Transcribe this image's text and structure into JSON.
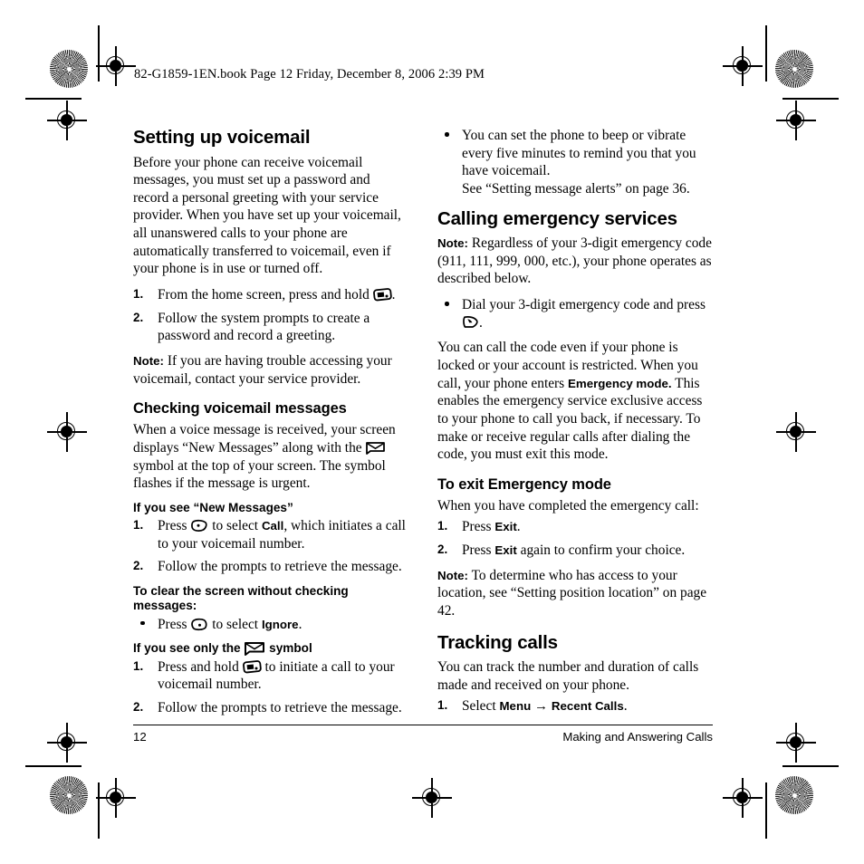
{
  "header": {
    "text": "82-G1859-1EN.book  Page 12  Friday, December 8, 2006  2:39 PM"
  },
  "left_column": {
    "heading": "Setting up voicemail",
    "intro": "Before your phone can receive voicemail messages, you must set up a password and record a personal greeting with your service provider. When you have set up your voicemail, all unanswered calls to your phone are automatically transferred to voicemail, even if your phone is in use or turned off.",
    "steps": [
      {
        "num": "1.",
        "text_before": "From the home screen, press and hold",
        "icon": "voicemail-key-icon",
        "text_after": "."
      },
      {
        "num": "2.",
        "text_before": "Follow the system prompts to create a password and record a greeting.",
        "icon": "",
        "text_after": ""
      }
    ],
    "note_label": "Note:",
    "note_text": "If you are having trouble accessing your voicemail, contact your service provider.",
    "sub_heading": "Checking voicemail messages",
    "sub_text_a": "When a voice message is received, your screen displays “New Messages” along with the",
    "sub_text_b": "symbol at the top of your screen. The symbol flashes if the message is urgent.",
    "minor_heading_1": "If you see “New Messages”",
    "steps_2": [
      {
        "num": "1.",
        "pre": "Press",
        "icon": "left-softkey-icon",
        "mid": "to select",
        "ui": "Call",
        "post": ", which initiates a call to your voicemail number."
      },
      {
        "num": "2.",
        "pre": "Follow the prompts to retrieve the message.",
        "icon": "",
        "mid": "",
        "ui": "",
        "post": ""
      }
    ],
    "clear_heading": "To clear the screen without checking messages:",
    "clear_bullet": {
      "pre": "Press",
      "icon": "right-softkey-icon",
      "mid": "to select",
      "ui": "Ignore",
      "post": "."
    },
    "minor_heading_2_a": "If you see only the",
    "minor_heading_2_icon": "envelope-icon",
    "minor_heading_2_b": "symbol",
    "steps_3": [
      {
        "num": "1.",
        "pre": "Press and hold",
        "icon": "voicemail-key-icon",
        "post": "to initiate a call to your voicemail number."
      },
      {
        "num": "2.",
        "pre": "Follow the prompts to retrieve the message.",
        "icon": "",
        "post": ""
      }
    ]
  },
  "right_column": {
    "top_bullet_line1": "You can set the phone to beep or vibrate every five minutes to remind you that you have voicemail.",
    "top_bullet_line2": "See “Setting message alerts” on page 36.",
    "heading": "Calling emergency services",
    "note_label": "Note:",
    "note_text": "Regardless of your 3-digit emergency code (911, 111, 999, 000, etc.), your phone operates as described below.",
    "dial_bullet_pre": "Dial your 3-digit emergency code and press",
    "dial_bullet_icon": "send-key-icon",
    "dial_bullet_post": ".",
    "body_a": "You can call the code even if your phone is locked or your account is restricted. When you call, your phone enters",
    "body_ui": "Emergency mode.",
    "body_b": "This enables the emergency service exclusive access to your phone to call you back, if necessary. To make or receive regular calls after dialing the code, you must exit this mode.",
    "sub_heading": "To exit Emergency mode",
    "sub_text": "When you have completed the emergency call:",
    "steps": [
      {
        "num": "1.",
        "pre": "Press",
        "ui": "Exit",
        "post": "."
      },
      {
        "num": "2.",
        "pre": "Press",
        "ui": "Exit",
        "post": "again to confirm your choice."
      }
    ],
    "note2_label": "Note:",
    "note2_text": "To determine who has access to your location, see “Setting position location” on page 42.",
    "tracking_heading": "Tracking calls",
    "tracking_text": "You can track the number and duration of calls made and received on your phone.",
    "tracking_step": {
      "num": "1.",
      "pre": "Select",
      "ui1": "Menu",
      "arrow": "→",
      "ui2": "Recent Calls",
      "post": "."
    }
  },
  "footer": {
    "page_number": "12",
    "section_title": "Making and Answering Calls"
  },
  "print_marks": {
    "star_target": "star-target-mark",
    "registration": "registration-mark",
    "trim_line": "trim-line"
  }
}
